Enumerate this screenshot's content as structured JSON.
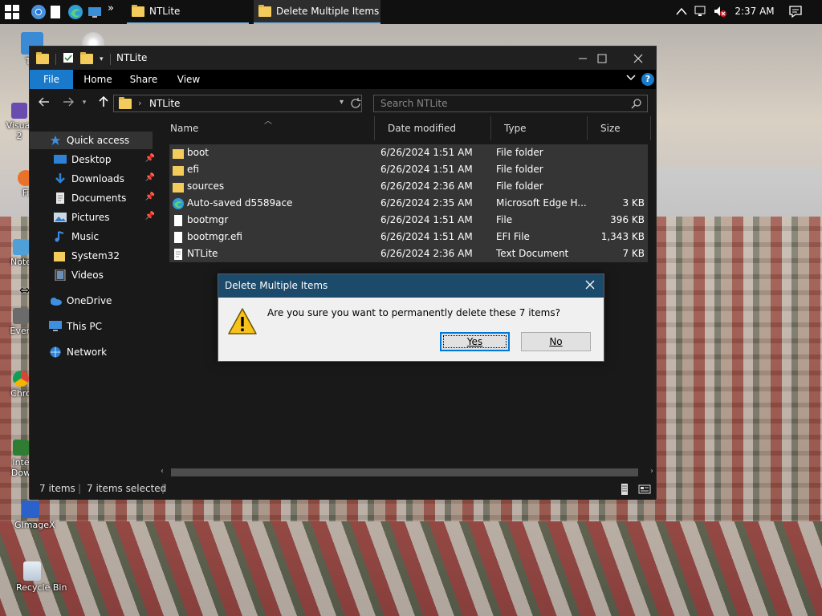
{
  "taskbar": {
    "tasks": [
      {
        "label": "NTLite"
      },
      {
        "label": "Delete Multiple Items"
      }
    ],
    "clock": "2:37 AM"
  },
  "desktop": {
    "icons": [
      "Thi",
      "Visual",
      "2",
      "Fi",
      "Note",
      "Even",
      "Chro",
      "Inte",
      "Dow",
      "GImageX",
      "Recycle Bin"
    ]
  },
  "explorer": {
    "title": "NTLite",
    "ribbon": [
      "File",
      "Home",
      "Share",
      "View"
    ],
    "address": {
      "path": "NTLite"
    },
    "search": {
      "placeholder": "Search NTLite"
    },
    "nav": [
      {
        "label": "Quick access",
        "icon": "star-icon"
      },
      {
        "label": "Desktop",
        "icon": "desktop-icon",
        "pinned": true
      },
      {
        "label": "Downloads",
        "icon": "download-icon",
        "pinned": true
      },
      {
        "label": "Documents",
        "icon": "documents-icon",
        "pinned": true
      },
      {
        "label": "Pictures",
        "icon": "pictures-icon",
        "pinned": true
      },
      {
        "label": "Music",
        "icon": "music-icon"
      },
      {
        "label": "System32",
        "icon": "folder-icon"
      },
      {
        "label": "Videos",
        "icon": "videos-icon"
      },
      {
        "label": "OneDrive",
        "icon": "cloud-icon"
      },
      {
        "label": "This PC",
        "icon": "computer-icon"
      },
      {
        "label": "Network",
        "icon": "network-icon"
      }
    ],
    "columns": [
      "Name",
      "Date modified",
      "Type",
      "Size"
    ],
    "files": [
      {
        "name": "boot",
        "date": "6/26/2024 1:51 AM",
        "type": "File folder",
        "size": "",
        "icon": "folder-icon"
      },
      {
        "name": "efi",
        "date": "6/26/2024 1:51 AM",
        "type": "File folder",
        "size": "",
        "icon": "folder-icon"
      },
      {
        "name": "sources",
        "date": "6/26/2024 2:36 AM",
        "type": "File folder",
        "size": "",
        "icon": "folder-icon"
      },
      {
        "name": "Auto-saved d5589ace",
        "date": "6/26/2024 2:35 AM",
        "type": "Microsoft Edge H...",
        "size": "3 KB",
        "icon": "edge-icon"
      },
      {
        "name": "bootmgr",
        "date": "6/26/2024 1:51 AM",
        "type": "File",
        "size": "396 KB",
        "icon": "file-icon"
      },
      {
        "name": "bootmgr.efi",
        "date": "6/26/2024 1:51 AM",
        "type": "EFI File",
        "size": "1,343 KB",
        "icon": "file-icon"
      },
      {
        "name": "NTLite",
        "date": "6/26/2024 2:36 AM",
        "type": "Text Document",
        "size": "7 KB",
        "icon": "text-file-icon"
      }
    ],
    "status": {
      "count": "7 items",
      "selected": "7 items selected"
    }
  },
  "dialog": {
    "title": "Delete Multiple Items",
    "message": "Are you sure you want to permanently delete these 7 items?",
    "yes": "Yes",
    "no": "No"
  },
  "colors": {
    "accent": "#1979ca",
    "dialog_title": "#1b4a6b",
    "folder": "#f3cc5c"
  }
}
